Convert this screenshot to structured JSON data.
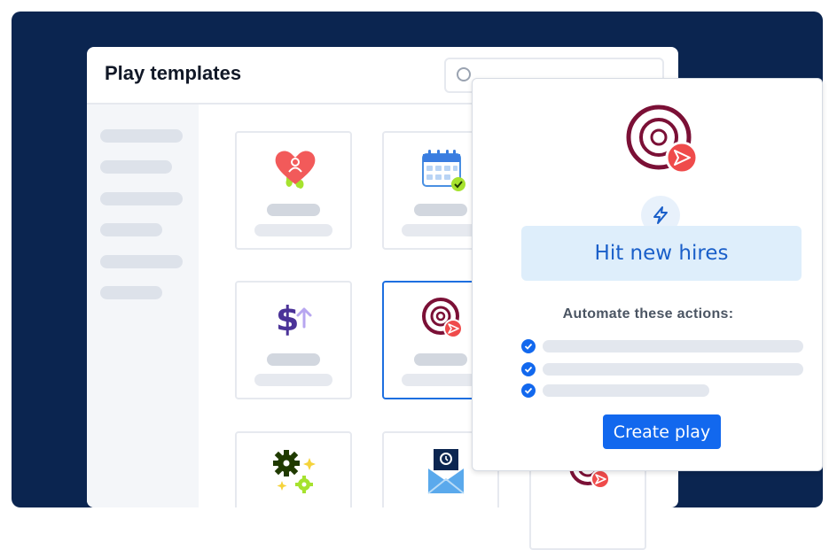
{
  "window": {
    "title": "Play templates",
    "search": {
      "placeholder": ""
    }
  },
  "sidebar": {
    "item_count": 6
  },
  "templates": [
    {
      "icon": "heart-person-icon"
    },
    {
      "icon": "calendar-check-icon"
    },
    {
      "icon": "dollar-up-icon"
    },
    {
      "icon": "target-send-icon",
      "selected": true
    },
    {
      "icon": "gears-sparkle-icon"
    },
    {
      "icon": "mail-history-icon"
    }
  ],
  "panel": {
    "title": "Hit new hires",
    "subtitle": "Automate these actions:",
    "actions_count": 3,
    "create_label": "Create play"
  },
  "colors": {
    "background": "#0b2550",
    "accent": "#1268ee",
    "target": "#7b1036",
    "send": "#ef4b4b"
  }
}
